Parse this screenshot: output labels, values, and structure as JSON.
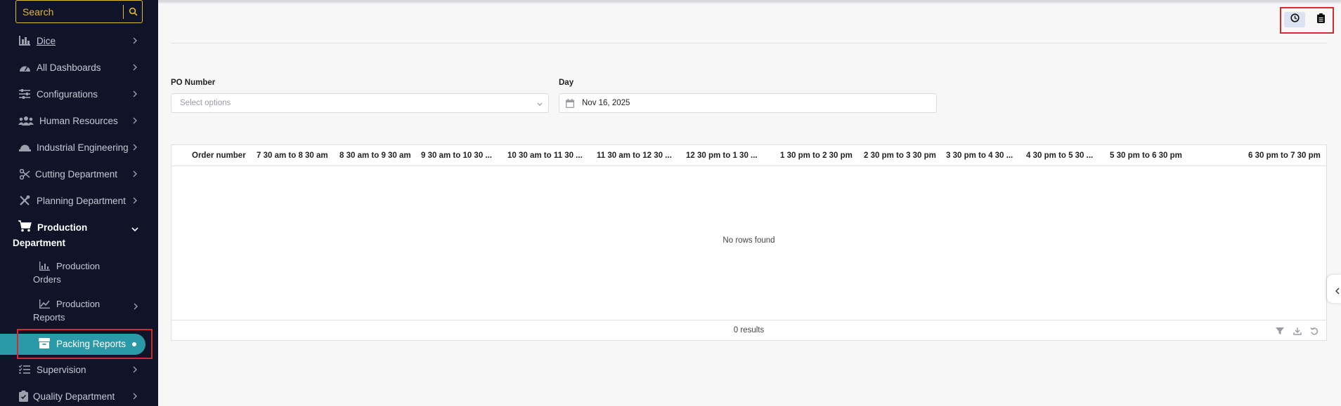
{
  "sidebar": {
    "search": {
      "placeholder": "Search"
    },
    "items": [
      {
        "label": "Dice"
      },
      {
        "label": "All Dashboards"
      },
      {
        "label": "Configurations"
      },
      {
        "label": "Human Resources"
      },
      {
        "label": "Industrial Engineering"
      },
      {
        "label": "Cutting Department"
      },
      {
        "label": "Planning Department"
      }
    ],
    "production": {
      "line1": "Production",
      "line2": "Department",
      "children": [
        {
          "line1": "Production",
          "line2": "Orders"
        },
        {
          "line1": "Production",
          "line2": "Reports"
        },
        {
          "label": "Packing Reports"
        }
      ]
    },
    "items_after": [
      {
        "label": "Supervision"
      },
      {
        "label": "Quality Department"
      }
    ]
  },
  "filters": {
    "po": {
      "label": "PO Number",
      "placeholder": "Select options"
    },
    "day": {
      "label": "Day",
      "value": "Nov 16, 2025"
    }
  },
  "table": {
    "columns": [
      "Order number",
      "7 30 am to 8 30 am",
      "8 30 am to 9 30 am",
      "9 30 am to 10 30 ...",
      "10 30 am to 11 30 ...",
      "11 30 am to 12 30 ...",
      "12 30 pm to 1 30 ...",
      "1 30 pm to 2 30 pm",
      "2 30 pm to 3 30 pm",
      "3 30 pm to 4 30 ...",
      "4 30 pm to 5 30 ...",
      "5 30 pm to 6 30 pm",
      "6 30 pm to 7 30 pm"
    ],
    "empty_text": "No rows found",
    "results_text": "0 results"
  },
  "colors": {
    "sidebar_bg": "#0f1428",
    "accent": "#2b9aa8",
    "search_border": "#e2b63a",
    "highlight": "#d42a2a"
  }
}
